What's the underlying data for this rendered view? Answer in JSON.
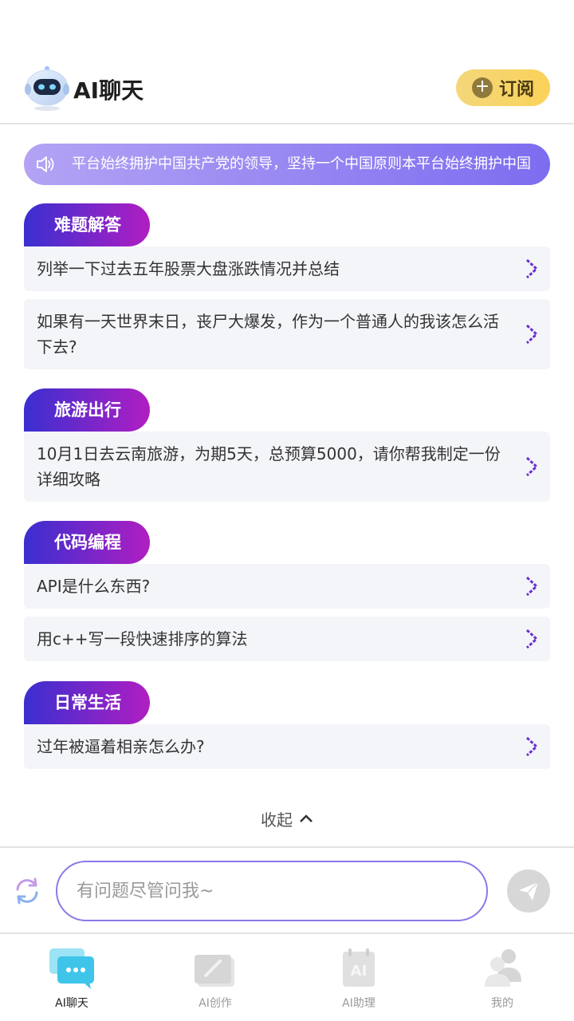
{
  "header": {
    "app_title": "AI聊天",
    "subscribe_label": "订阅"
  },
  "notice": {
    "text": "平台始终拥护中国共产党的领导，坚持一个中国原则本平台始终拥护中国共"
  },
  "categories": [
    {
      "tag": "难题解答",
      "questions": [
        "列举一下过去五年股票大盘涨跌情况并总结",
        "如果有一天世界末日，丧尸大爆发，作为一个普通人的我该怎么活下去?"
      ]
    },
    {
      "tag": "旅游出行",
      "questions": [
        "10月1日去云南旅游，为期5天，总预算5000，请你帮我制定一份详细攻略"
      ]
    },
    {
      "tag": "代码编程",
      "questions": [
        "API是什么东西?",
        "用c++写一段快速排序的算法"
      ]
    },
    {
      "tag": "日常生活",
      "questions": [
        "过年被逼着相亲怎么办?"
      ]
    }
  ],
  "collapse_label": "收起",
  "input": {
    "placeholder": "有问题尽管问我~"
  },
  "tabs": [
    {
      "label": "AI聊天",
      "active": true
    },
    {
      "label": "AI创作",
      "active": false
    },
    {
      "label": "AI助理",
      "active": false
    },
    {
      "label": "我的",
      "active": false
    }
  ],
  "colors": {
    "accent_purple": "#7c6df0",
    "tag_gradient_start": "#3a2fd0",
    "tag_gradient_end": "#b01ec2",
    "subscribe_gold": "#fad25a"
  }
}
